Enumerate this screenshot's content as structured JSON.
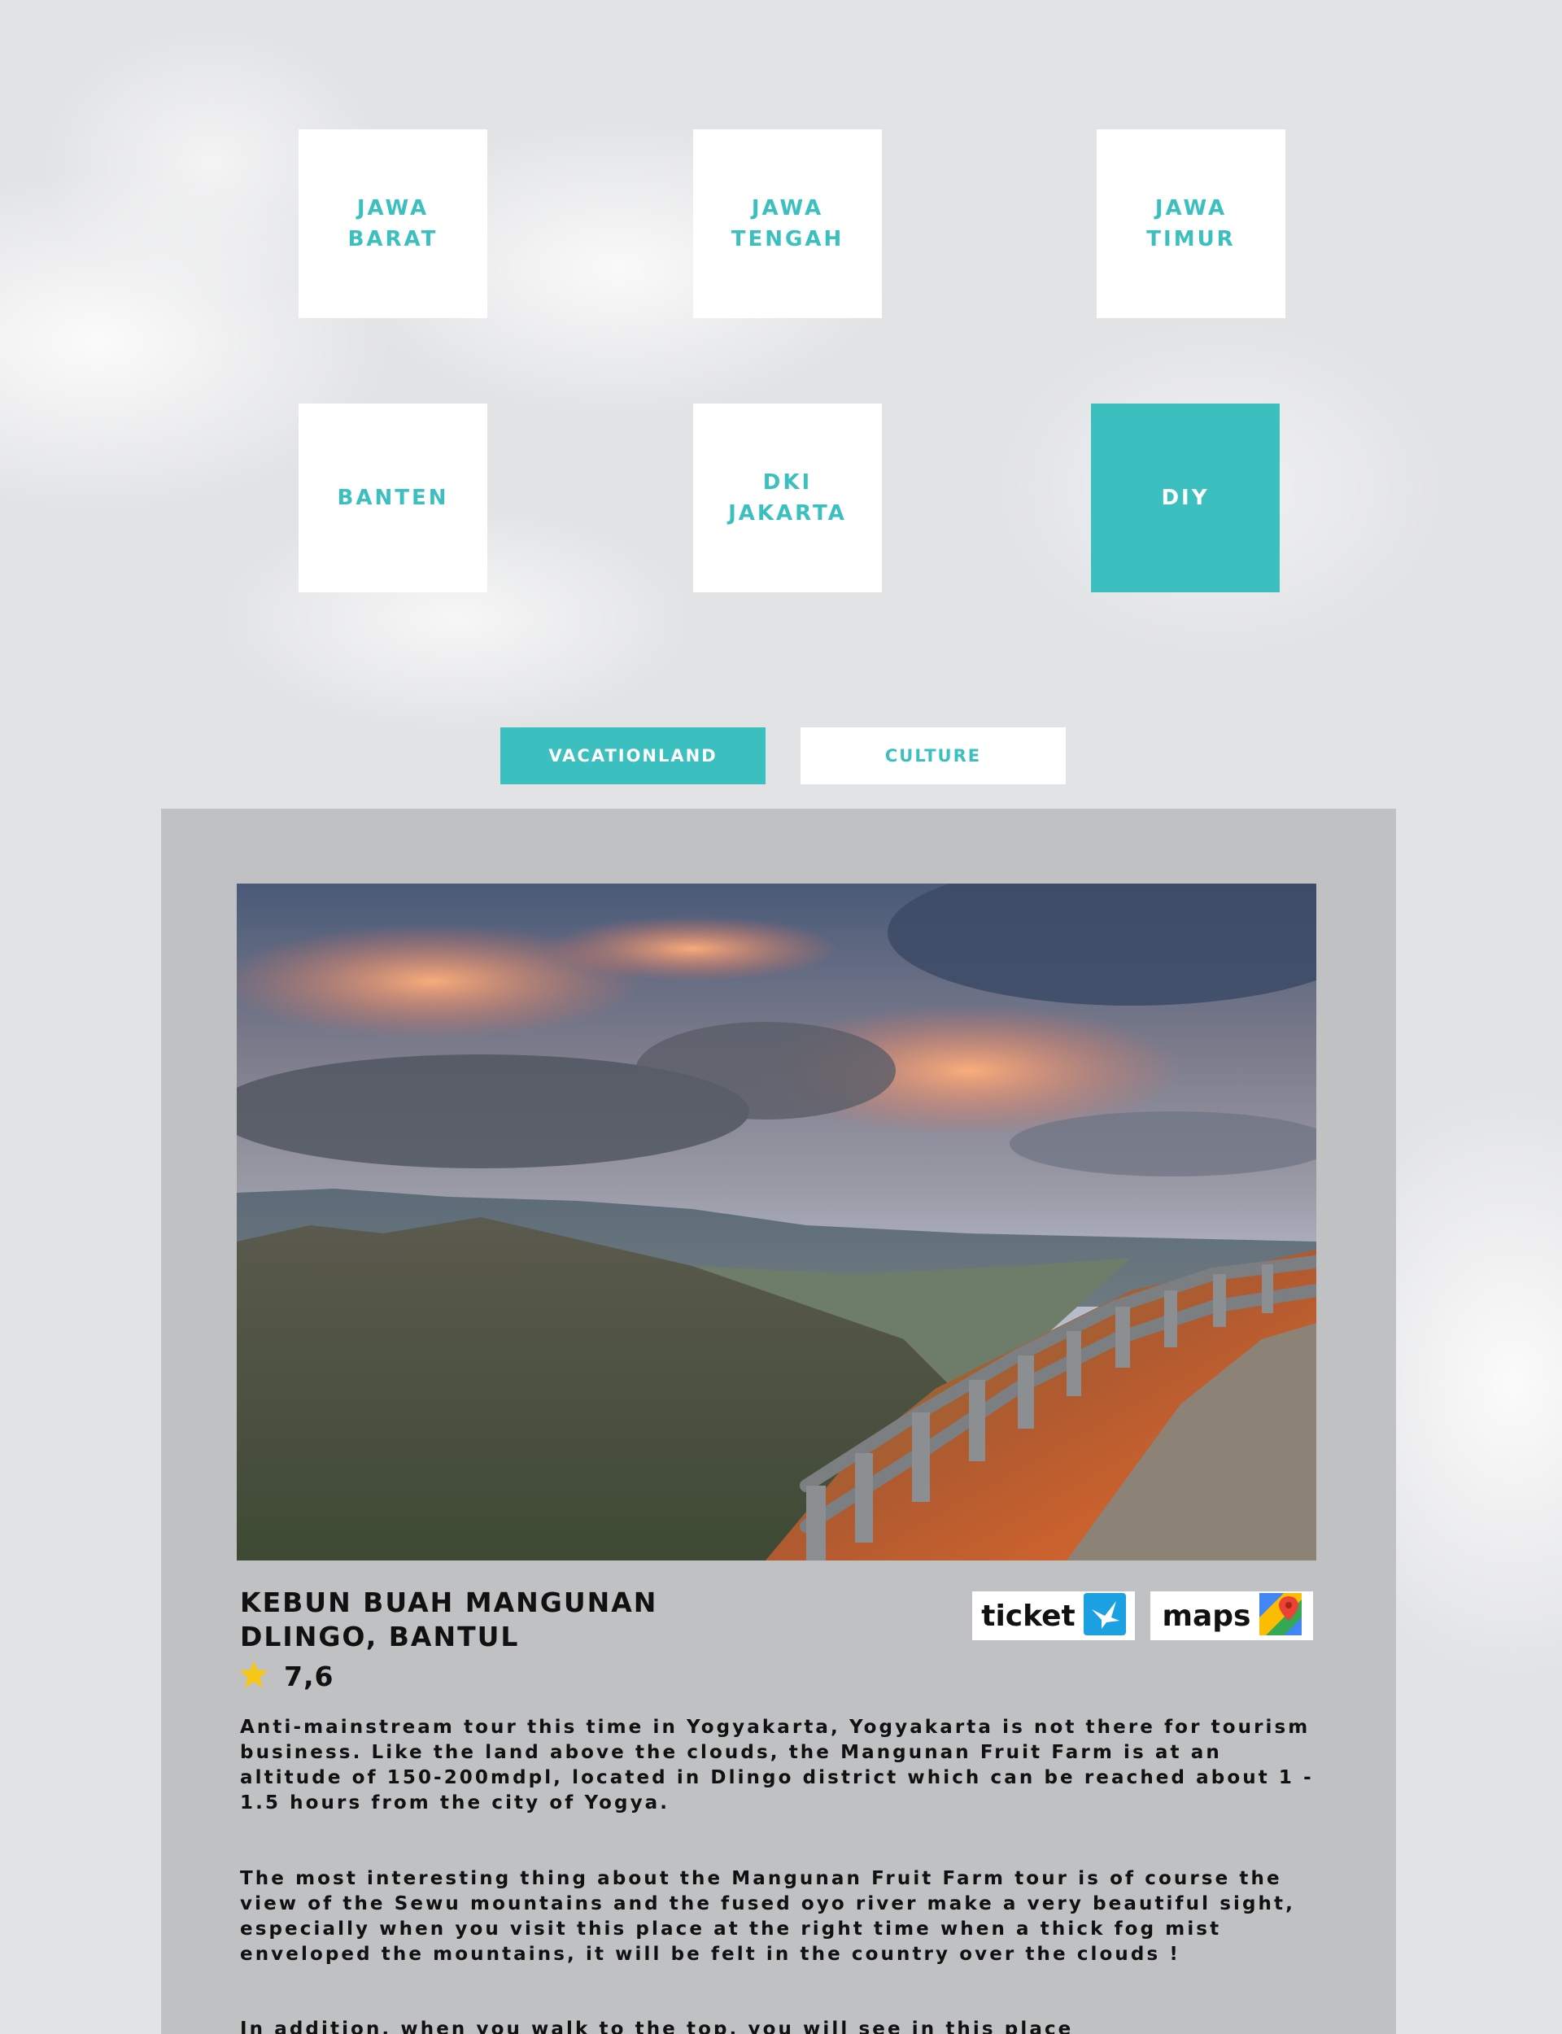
{
  "regions": [
    {
      "label": "JAWA\nBARAT"
    },
    {
      "label": "JAWA\nTENGAH"
    },
    {
      "label": "JAWA\nTIMUR"
    },
    {
      "label": "BANTEN"
    },
    {
      "label": "DKI\nJAKARTA"
    },
    {
      "label": "DIY"
    }
  ],
  "active_region": "DIY",
  "categories": {
    "vacationland": "VACATIONLAND",
    "culture": "CULTURE",
    "active": "VACATIONLAND"
  },
  "place": {
    "name": "KEBUN BUAH MANGUNAN",
    "location": "DLINGO, BANTUL",
    "rating": "7,6",
    "ticket_label": "ticket",
    "maps_label": "maps",
    "paragraphs": [
      "Anti-mainstream tour this time in Yogyakarta, Yogyakarta is not there for tourism business. Like the land above the clouds, the Mangunan Fruit Farm is at an altitude of 150-200mdpl, located in Dlingo district which can be reached about 1 - 1.5 hours from the city of Yogya.",
      "The most interesting thing about the Mangunan Fruit Farm tour is of course the view of the Sewu mountains and the fused oyo river make a very beautiful sight, especially when you visit this place at the right time when a thick fog mist enveloped the mountains, it will be felt in the country over the clouds !",
      "In addition, when you walk to the top, you will see in this place"
    ]
  },
  "colors": {
    "accent": "#3cbfbf",
    "panel": "#c0c1c3",
    "page_background": "#e2e3e5",
    "star": "#f5c518"
  },
  "icons": {
    "rating": "star-icon",
    "ticket": "traveloka-bird-icon",
    "maps": "google-maps-pin-icon"
  }
}
